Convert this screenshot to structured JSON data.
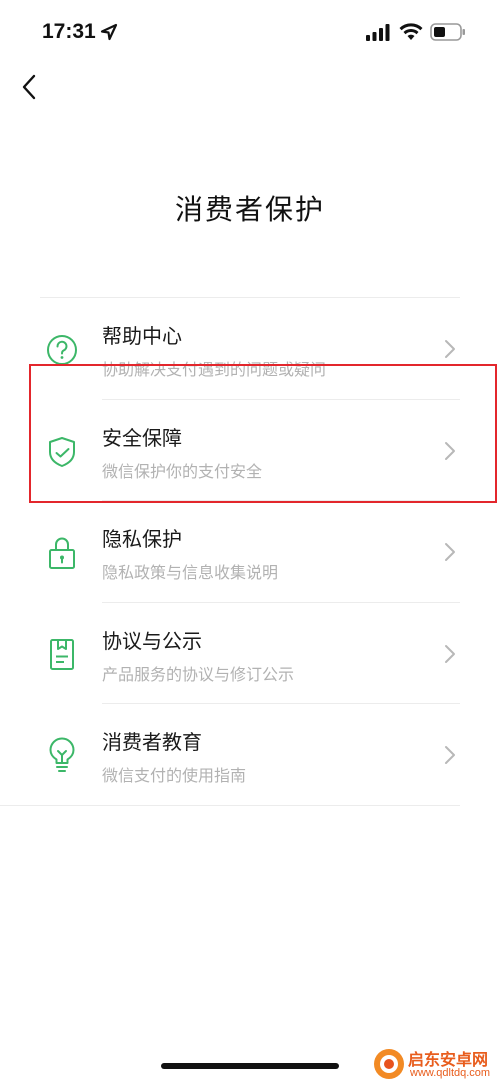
{
  "status_bar": {
    "time": "17:31",
    "icons": [
      "location-arrow-icon",
      "cellular-signal-icon",
      "wifi-icon",
      "battery-icon"
    ]
  },
  "nav": {
    "back_icon": "chevron-left-icon"
  },
  "page": {
    "title": "消费者保护"
  },
  "menu": {
    "items": [
      {
        "icon": "question-circle-icon",
        "label": "帮助中心",
        "subtitle": "协助解决支付遇到的问题或疑问"
      },
      {
        "icon": "shield-check-icon",
        "label": "安全保障",
        "subtitle": "微信保护你的支付安全"
      },
      {
        "icon": "lock-icon",
        "label": "隐私保护",
        "subtitle": "隐私政策与信息收集说明"
      },
      {
        "icon": "document-icon",
        "label": "协议与公示",
        "subtitle": "产品服务的协议与修订公示"
      },
      {
        "icon": "lightbulb-icon",
        "label": "消费者教育",
        "subtitle": "微信支付的使用指南"
      }
    ]
  },
  "annotation": {
    "highlighted_item": "安全保障",
    "color": "#e3262c"
  },
  "watermark": {
    "name": "启东安卓网",
    "url": "www.qdltdq.com"
  },
  "colors": {
    "icon_green": "#3cb768",
    "subtitle_gray": "#b2b2b2",
    "divider": "#ececec"
  }
}
